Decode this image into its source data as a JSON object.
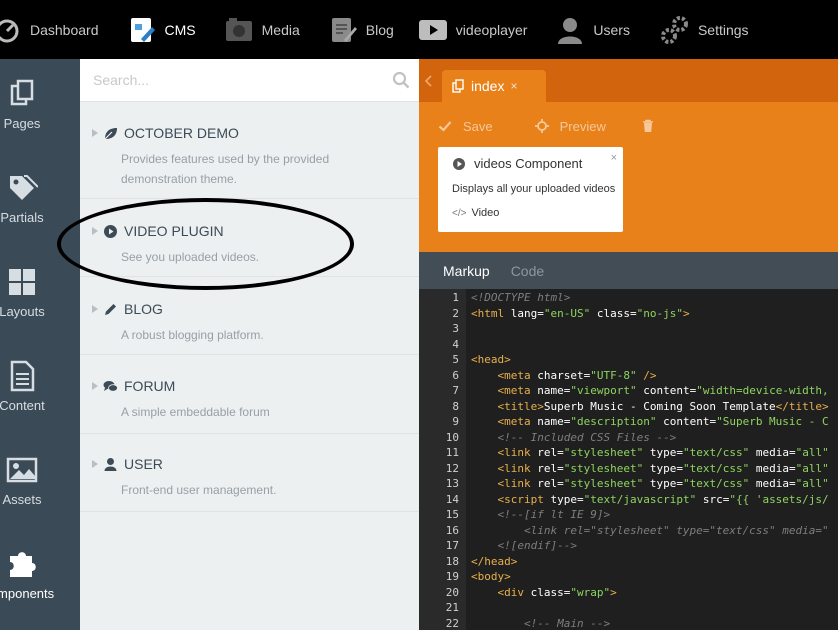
{
  "topnav": {
    "items": [
      {
        "label": "Dashboard",
        "icon": "dashboard-icon"
      },
      {
        "label": "CMS",
        "icon": "cms-icon",
        "active": true
      },
      {
        "label": "Media",
        "icon": "media-icon"
      },
      {
        "label": "Blog",
        "icon": "blog-icon"
      },
      {
        "label": "videoplayer",
        "icon": "video-player-icon"
      },
      {
        "label": "Users",
        "icon": "users-icon"
      },
      {
        "label": "Settings",
        "icon": "settings-icon"
      }
    ]
  },
  "sidebar": {
    "items": [
      {
        "label": "Pages",
        "icon": "pages-icon"
      },
      {
        "label": "Partials",
        "icon": "partials-icon"
      },
      {
        "label": "Layouts",
        "icon": "layouts-icon"
      },
      {
        "label": "Content",
        "icon": "content-icon"
      },
      {
        "label": "Assets",
        "icon": "assets-icon"
      },
      {
        "label": "omponents",
        "icon": "components-icon",
        "active": true
      }
    ]
  },
  "panel": {
    "search_placeholder": "Search...",
    "plugins": [
      {
        "title": "OCTOBER DEMO",
        "desc": "Provides features used by the provided demonstration theme.",
        "icon": "leaf-icon"
      },
      {
        "title": "VIDEO PLUGIN",
        "desc": "See you uploaded videos.",
        "icon": "play-circle-icon"
      },
      {
        "title": "BLOG",
        "desc": "A robust blogging platform.",
        "icon": "pencil-icon"
      },
      {
        "title": "FORUM",
        "desc": "A simple embeddable forum",
        "icon": "comments-icon"
      },
      {
        "title": "USER",
        "desc": "Front-end user management.",
        "icon": "user-icon"
      }
    ]
  },
  "editor": {
    "tab": {
      "label": "index",
      "close": "×"
    },
    "toolbar": {
      "save": "Save",
      "preview": "Preview"
    },
    "component": {
      "title": "videos Component",
      "desc": "Displays all your uploaded videos",
      "alias": "Video",
      "close": "×"
    },
    "modes": {
      "markup": "Markup",
      "code": "Code"
    }
  },
  "code": {
    "lines": [
      {
        "n": "1",
        "segs": [
          [
            "com",
            "<!DOCTYPE html>"
          ]
        ]
      },
      {
        "n": "2",
        "segs": [
          [
            "tag",
            "<html "
          ],
          [
            "attr",
            "lang="
          ],
          [
            "str",
            "\"en-US\""
          ],
          [
            "attr",
            " class="
          ],
          [
            "str",
            "\"no-js\""
          ],
          [
            "tag",
            ">"
          ]
        ]
      },
      {
        "n": "3",
        "segs": []
      },
      {
        "n": "4",
        "segs": []
      },
      {
        "n": "5",
        "segs": [
          [
            "tag",
            "<head>"
          ]
        ]
      },
      {
        "n": "6",
        "segs": [
          [
            "txt",
            "    "
          ],
          [
            "tag",
            "<meta "
          ],
          [
            "attr",
            "charset="
          ],
          [
            "str",
            "\"UTF-8\""
          ],
          [
            "tag",
            " />"
          ]
        ]
      },
      {
        "n": "7",
        "segs": [
          [
            "txt",
            "    "
          ],
          [
            "tag",
            "<meta "
          ],
          [
            "attr",
            "name="
          ],
          [
            "str",
            "\"viewport\""
          ],
          [
            "attr",
            " content="
          ],
          [
            "str",
            "\"width=device-width,"
          ]
        ]
      },
      {
        "n": "8",
        "segs": [
          [
            "txt",
            "    "
          ],
          [
            "tag",
            "<title>"
          ],
          [
            "txt",
            "Superb Music - Coming Soon Template"
          ],
          [
            "tag",
            "</title>"
          ]
        ]
      },
      {
        "n": "9",
        "segs": [
          [
            "txt",
            "    "
          ],
          [
            "tag",
            "<meta "
          ],
          [
            "attr",
            "name="
          ],
          [
            "str",
            "\"description\""
          ],
          [
            "attr",
            " content="
          ],
          [
            "str",
            "\"Superb Music - C"
          ]
        ]
      },
      {
        "n": "10",
        "segs": [
          [
            "txt",
            "    "
          ],
          [
            "com",
            "<!-- Included CSS Files -->"
          ]
        ]
      },
      {
        "n": "11",
        "segs": [
          [
            "txt",
            "    "
          ],
          [
            "tag",
            "<link "
          ],
          [
            "attr",
            "rel="
          ],
          [
            "str",
            "\"stylesheet\""
          ],
          [
            "attr",
            " type="
          ],
          [
            "str",
            "\"text/css\""
          ],
          [
            "attr",
            " media="
          ],
          [
            "str",
            "\"all\""
          ]
        ]
      },
      {
        "n": "12",
        "segs": [
          [
            "txt",
            "    "
          ],
          [
            "tag",
            "<link "
          ],
          [
            "attr",
            "rel="
          ],
          [
            "str",
            "\"stylesheet\""
          ],
          [
            "attr",
            " type="
          ],
          [
            "str",
            "\"text/css\""
          ],
          [
            "attr",
            " media="
          ],
          [
            "str",
            "\"all\""
          ]
        ]
      },
      {
        "n": "13",
        "segs": [
          [
            "txt",
            "    "
          ],
          [
            "tag",
            "<link "
          ],
          [
            "attr",
            "rel="
          ],
          [
            "str",
            "\"stylesheet\""
          ],
          [
            "attr",
            " type="
          ],
          [
            "str",
            "\"text/css\""
          ],
          [
            "attr",
            " media="
          ],
          [
            "str",
            "\"all\""
          ]
        ]
      },
      {
        "n": "14",
        "segs": [
          [
            "txt",
            "    "
          ],
          [
            "tag",
            "<script "
          ],
          [
            "attr",
            "type="
          ],
          [
            "str",
            "\"text/javascript\""
          ],
          [
            "attr",
            " src="
          ],
          [
            "str",
            "\"{{ 'assets/js/"
          ]
        ]
      },
      {
        "n": "15",
        "segs": [
          [
            "txt",
            "    "
          ],
          [
            "com",
            "<!--[if lt IE 9]>"
          ]
        ]
      },
      {
        "n": "16",
        "segs": [
          [
            "txt",
            "        "
          ],
          [
            "com",
            "<link rel=\"stylesheet\" type=\"text/css\" media=\""
          ]
        ]
      },
      {
        "n": "17",
        "segs": [
          [
            "txt",
            "    "
          ],
          [
            "com",
            "<![endif]-->"
          ]
        ]
      },
      {
        "n": "18",
        "segs": [
          [
            "tag",
            "</head>"
          ]
        ]
      },
      {
        "n": "19",
        "segs": [
          [
            "tag",
            "<body>"
          ]
        ]
      },
      {
        "n": "20",
        "segs": [
          [
            "txt",
            "    "
          ],
          [
            "tag",
            "<div "
          ],
          [
            "attr",
            "class="
          ],
          [
            "str",
            "\"wrap\""
          ],
          [
            "tag",
            ">"
          ]
        ]
      },
      {
        "n": "21",
        "segs": []
      },
      {
        "n": "22",
        "segs": [
          [
            "txt",
            "        "
          ],
          [
            "com",
            "<!-- Main -->"
          ]
        ]
      }
    ]
  },
  "colors": {
    "accent": "#e8811a",
    "tabbar": "#d3640e",
    "sidebar": "#3b4a57"
  }
}
